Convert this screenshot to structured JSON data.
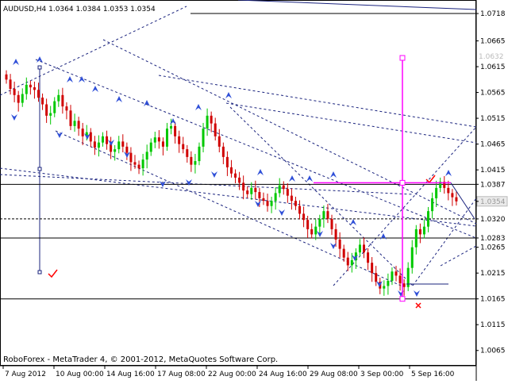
{
  "window": {
    "symbol_header": "AUDUSD,H4  1.0364 1.0384 1.0353 1.0354",
    "copyright": "RoboForex - MetaTrader 4, © 2001-2012, MetaQuotes Software Corp."
  },
  "colors": {
    "bull": "#00c800",
    "bear": "#d00000",
    "pattern_arrow": "#2f4fd8",
    "target_line": "#ff00ff",
    "check_mark": "#ff0000",
    "grid_line": "#000000",
    "dashed_line": "#1a237e"
  },
  "price_levels": [
    {
      "value": 1.0718,
      "label": "1.0718",
      "highlight": true
    },
    {
      "value": 1.0665,
      "label": "1.0665"
    },
    {
      "value": 1.0615,
      "label": "1.0615"
    },
    {
      "value": 1.0565,
      "label": "1.0565"
    },
    {
      "value": 1.0515,
      "label": "1.0515"
    },
    {
      "value": 1.0465,
      "label": "1.0465"
    },
    {
      "value": 1.0415,
      "label": "1.0415"
    },
    {
      "value": 1.0387,
      "label": "1.0387",
      "highlight": true
    },
    {
      "value": 1.0354,
      "label": "1.0354",
      "current": true
    },
    {
      "value": 1.032,
      "label": "1.0320",
      "highlight": true
    },
    {
      "value": 1.0283,
      "label": "1.0283",
      "highlight": true
    },
    {
      "value": 1.0265,
      "label": "1.0265"
    },
    {
      "value": 1.0215,
      "label": "1.0215"
    },
    {
      "value": 1.0165,
      "label": "1.0165",
      "highlight": true
    },
    {
      "value": 1.0115,
      "label": "1.0115"
    },
    {
      "value": 1.0065,
      "label": "1.0065"
    }
  ],
  "time_labels": [
    "7 Aug 2012",
    "10 Aug 00:00",
    "14 Aug 16:00",
    "17 Aug 08:00",
    "22 Aug 00:00",
    "24 Aug 16:00",
    "29 Aug 08:00",
    "3 Sep 00:00",
    "5 Sep 16:00"
  ],
  "target_label": "1.0632",
  "chart_data": {
    "type": "candlestick",
    "symbol": "AUDUSD",
    "timeframe": "H4",
    "last_bar": {
      "open": 1.0364,
      "high": 1.0384,
      "low": 1.0353,
      "close": 1.0354
    },
    "ylim": [
      1.004,
      1.0735
    ],
    "horizontal_levels": [
      1.0387,
      1.032,
      1.0283,
      1.0165
    ],
    "target_level": 1.0632,
    "close_path": [
      1.059,
      1.0572,
      1.056,
      1.0545,
      1.0562,
      1.058,
      1.0575,
      1.057,
      1.0555,
      1.0542,
      1.052,
      1.0525,
      1.0548,
      1.056,
      1.0538,
      1.053,
      1.05,
      1.051,
      1.0495,
      1.048,
      1.0488,
      1.047,
      1.0458,
      1.0468,
      1.048,
      1.0465,
      1.045,
      1.0455,
      1.047,
      1.046,
      1.0448,
      1.043,
      1.0425,
      1.0418,
      1.0435,
      1.045,
      1.0468,
      1.0478,
      1.047,
      1.046,
      1.0495,
      1.05,
      1.048,
      1.0465,
      1.0455,
      1.044,
      1.0425,
      1.0432,
      1.046,
      1.0495,
      1.052,
      1.0505,
      1.048,
      1.046,
      1.044,
      1.042,
      1.0408,
      1.04,
      1.039,
      1.0375,
      1.0368,
      1.038,
      1.0372,
      1.036,
      1.0355,
      1.0345,
      1.0355,
      1.037,
      1.0385,
      1.0378,
      1.0365,
      1.0355,
      1.0345,
      1.033,
      1.0318,
      1.03,
      1.029,
      1.0305,
      1.032,
      1.0335,
      1.032,
      1.03,
      1.028,
      1.0262,
      1.0245,
      1.023,
      1.024,
      1.0255,
      1.027,
      1.0255,
      1.0235,
      1.0215,
      1.0198,
      1.0185,
      1.019,
      1.02,
      1.0218,
      1.021,
      1.0195,
      1.0188,
      1.0225,
      1.0265,
      1.03,
      1.029,
      1.0305,
      1.0335,
      1.036,
      1.038,
      1.0392,
      1.038,
      1.037,
      1.0362,
      1.0354
    ]
  }
}
